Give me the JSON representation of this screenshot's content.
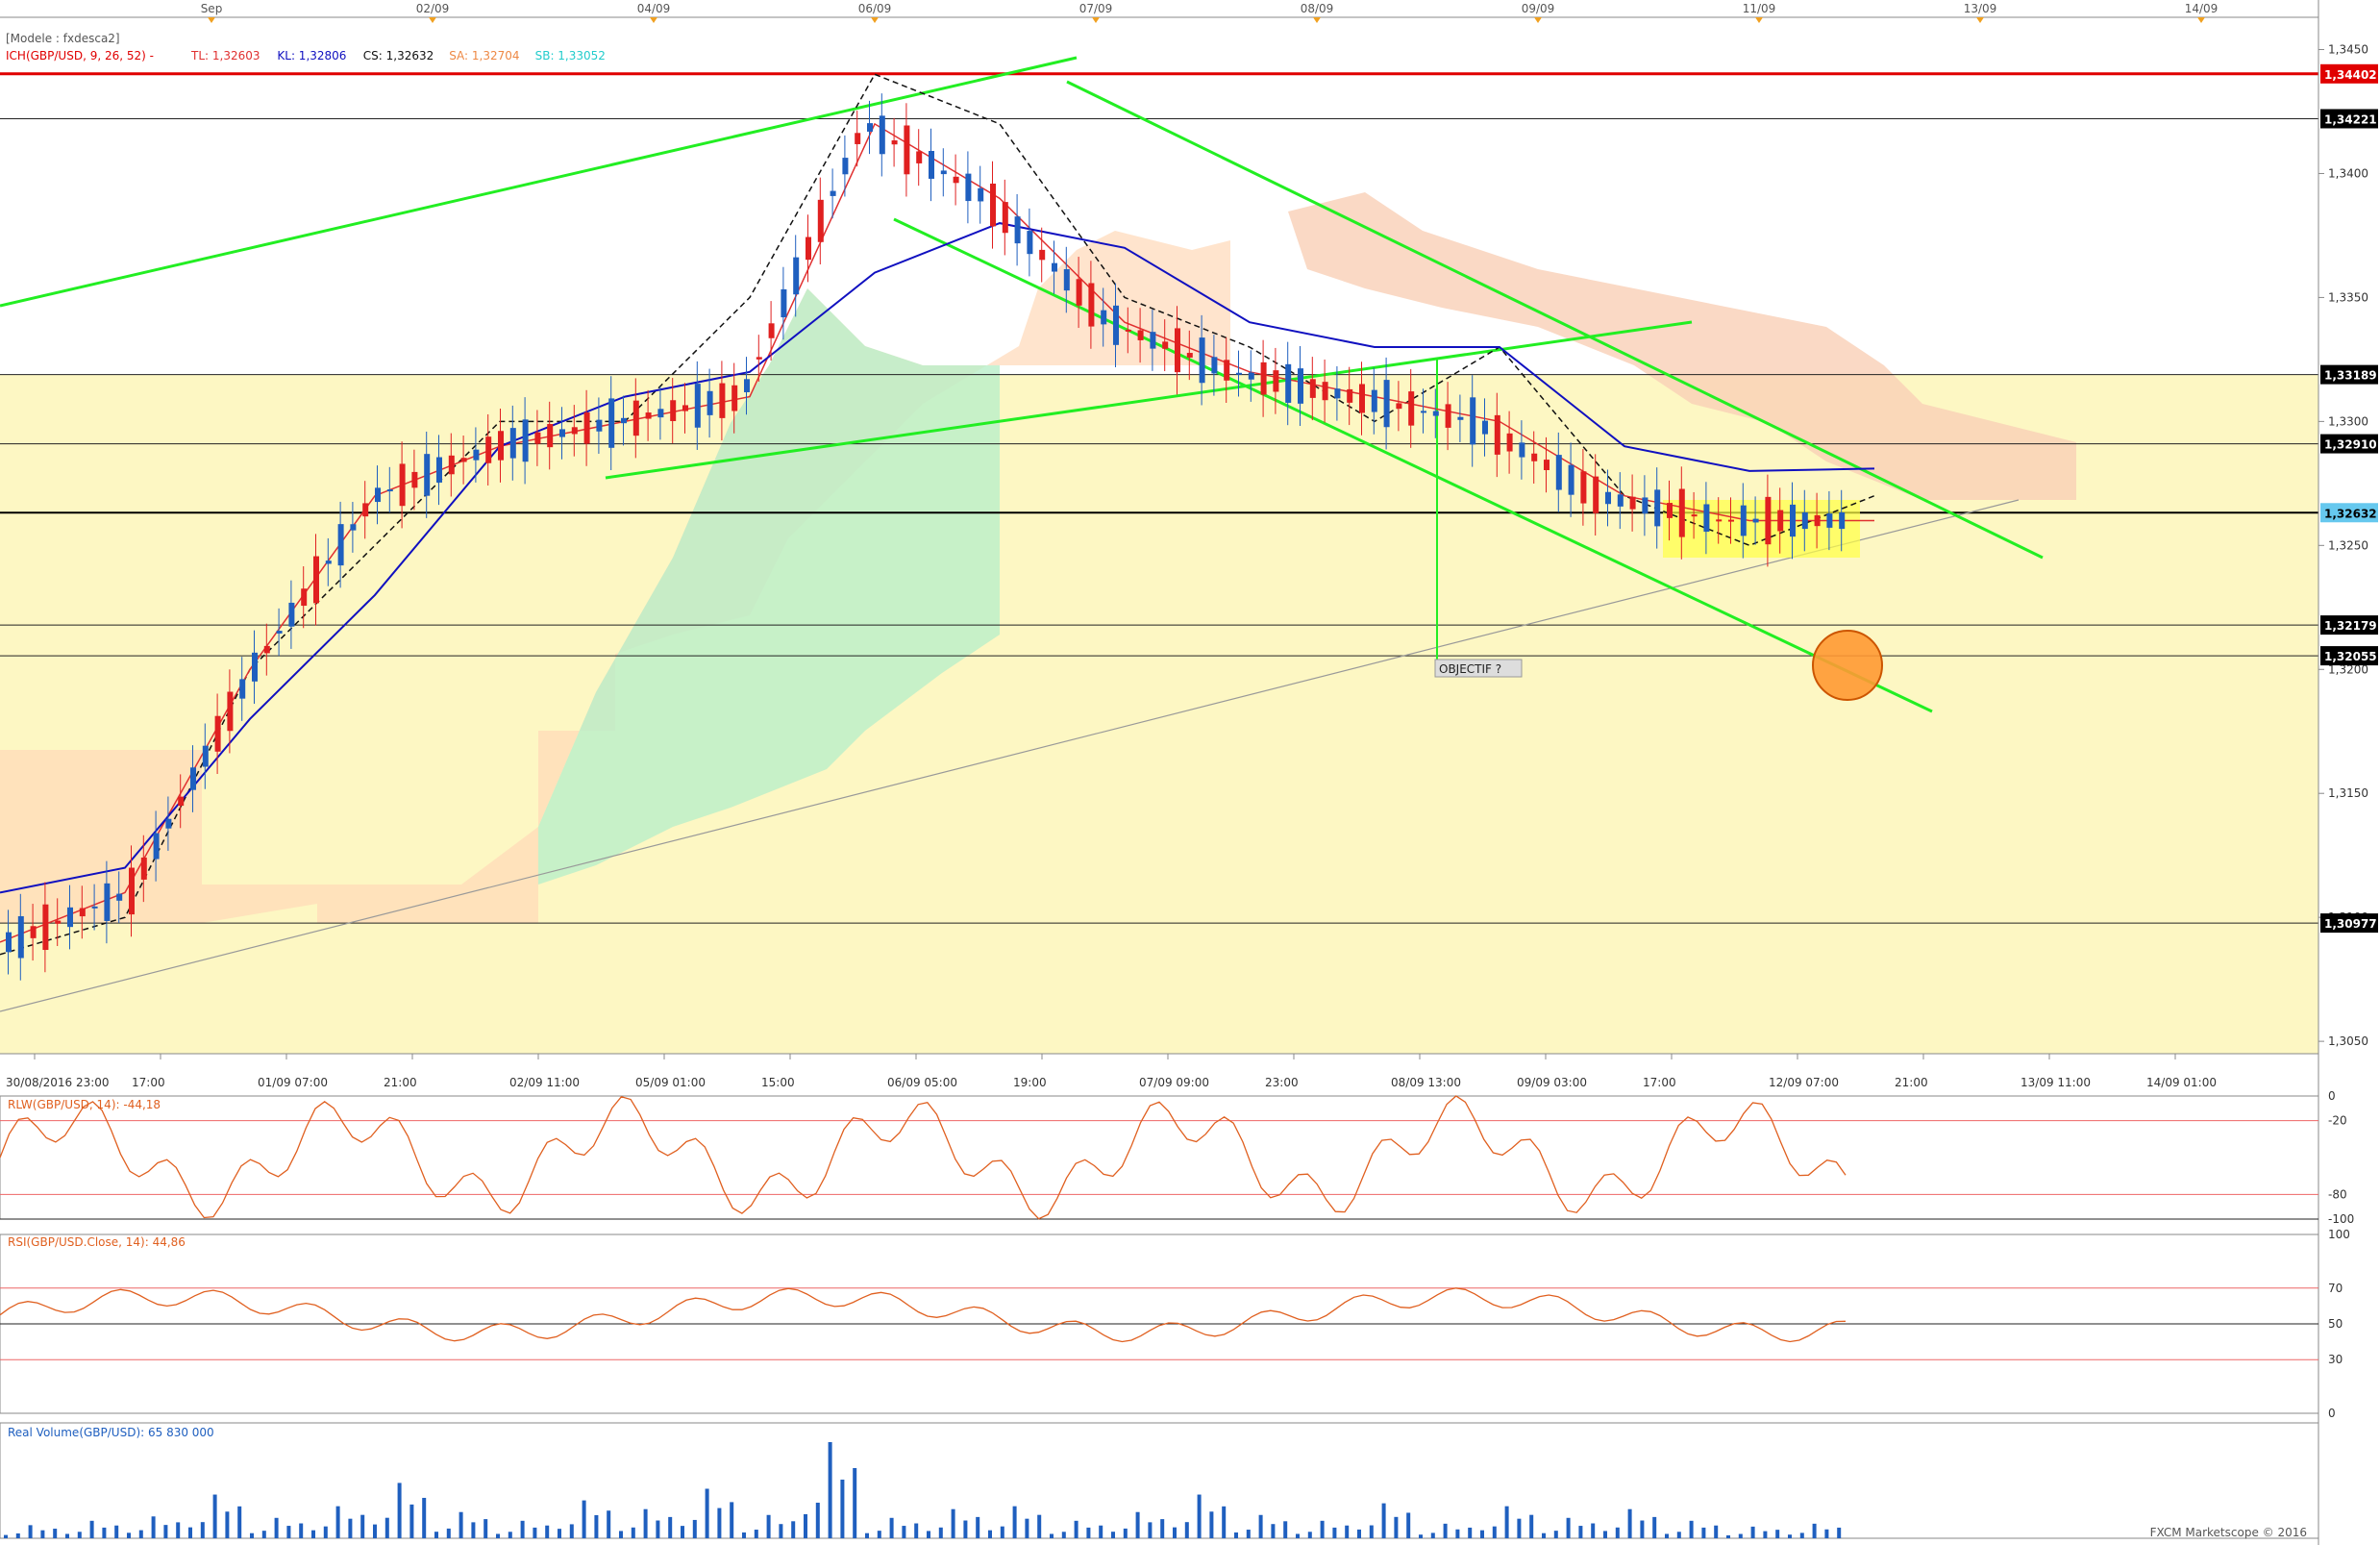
{
  "header": {
    "model": "[Modele : fxdesca2]",
    "ich": "ICH(GBP/USD, 9, 26, 52) -",
    "tl": "TL: 1,32603",
    "kl": "KL: 1,32806",
    "cs": "CS: 1,32632",
    "sa": "SA: 1,32704",
    "sb": "SB: 1,33052"
  },
  "top_dates": [
    "Sep",
    "02/09",
    "04/09",
    "06/09",
    "07/09",
    "08/09",
    "09/09",
    "11/09",
    "13/09",
    "14/09"
  ],
  "bottom_times": [
    "30/08/2016 23:00",
    "17:00",
    "01/09 07:00",
    "21:00",
    "02/09 11:00",
    "05/09 01:00",
    "15:00",
    "06/09 05:00",
    "19:00",
    "07/09 09:00",
    "23:00",
    "08/09 13:00",
    "09/09 03:00",
    "17:00",
    "12/09 07:00",
    "21:00",
    "13/09 11:00",
    "14/09 01:00"
  ],
  "price_ticks": [
    "1,3450",
    "1,3400",
    "1,3350",
    "1,3300",
    "1,3250",
    "1,3200",
    "1,3150",
    "1,3100",
    "1,3050"
  ],
  "levels": {
    "red": "1,34402",
    "l1": "1,34221",
    "l2": "1,33189",
    "l3": "1,32910",
    "cur": "1,32632",
    "l4": "1,32179",
    "l5": "1,32055",
    "l6": "1,30977"
  },
  "annotation": "OBJECTIF ?",
  "rlw": {
    "label": "RLW(GBP/USD, 14): -44,18",
    "ticks": [
      "0",
      "-20",
      "-80",
      "-100"
    ]
  },
  "rsi": {
    "label": "RSI(GBP/USD.Close, 14): 44,86",
    "ticks": [
      "100",
      "70",
      "50",
      "30",
      "0"
    ]
  },
  "volume": {
    "label": "Real Volume(GBP/USD): 65 830 000"
  },
  "copyright": "FXCM Marketscope © 2016",
  "colors": {
    "up": "#1f5fbf",
    "down": "#e02020",
    "tenkan": "#e03030",
    "kijun": "#1010c0",
    "spanA": "#ee9966",
    "spanB": "#44dddd",
    "trend": "#22ee22",
    "zone": "#fdf7c3",
    "resistance": "#e00000"
  },
  "chart_data": {
    "type": "line",
    "instrument": "GBP/USD",
    "x_start": "30/08/2016 23:00",
    "x_end": "14/09 01:00",
    "ylim": [
      1.3045,
      1.3463
    ],
    "series": [
      {
        "name": "CS",
        "values": [
          1.3085,
          1.31,
          1.32,
          1.325,
          1.33,
          1.33,
          1.335,
          1.344,
          1.342,
          1.335,
          1.333,
          1.33,
          1.333,
          1.327,
          1.325,
          1.327
        ]
      },
      {
        "name": "TL",
        "values": [
          1.309,
          1.311,
          1.32,
          1.327,
          1.329,
          1.33,
          1.331,
          1.342,
          1.339,
          1.334,
          1.332,
          1.331,
          1.33,
          1.327,
          1.326,
          1.326
        ]
      },
      {
        "name": "KL",
        "values": [
          1.311,
          1.312,
          1.318,
          1.323,
          1.329,
          1.331,
          1.332,
          1.336,
          1.338,
          1.337,
          1.334,
          1.333,
          1.333,
          1.329,
          1.328,
          1.3281
        ]
      }
    ],
    "volume": [
      9,
      12,
      15,
      30,
      14,
      22,
      38,
      18,
      12,
      26,
      20,
      34,
      16,
      66,
      14,
      20,
      22,
      12,
      18,
      30,
      16,
      12,
      24,
      10,
      22,
      14,
      20,
      12,
      8,
      10
    ]
  }
}
